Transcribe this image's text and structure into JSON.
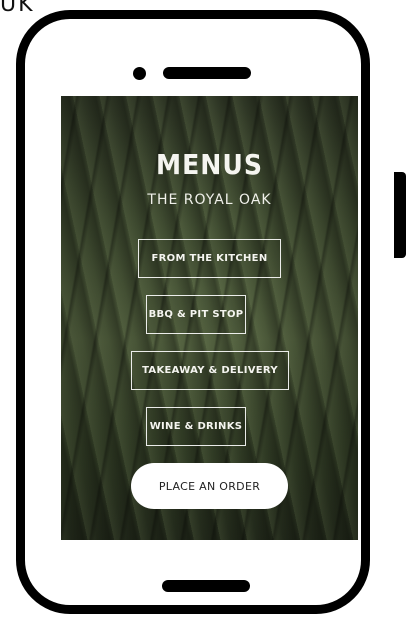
{
  "corner_text": "UK",
  "header": {
    "title": "MENUS",
    "subtitle": "THE ROYAL OAK"
  },
  "menu": {
    "items": [
      {
        "label": "FROM THE KITCHEN"
      },
      {
        "label": "BBQ & PIT STOP"
      },
      {
        "label": "TAKEAWAY & DELIVERY"
      },
      {
        "label": "WINE & DRINKS"
      }
    ],
    "order_label": "PLACE AN ORDER"
  },
  "colors": {
    "phone_frame": "#000000",
    "button_text": "#f5f5f0",
    "order_button_bg": "#ffffff",
    "screen_bg": "#4b5a3a"
  },
  "icons": [
    "camera-icon",
    "speaker-icon",
    "home-indicator-icon"
  ]
}
